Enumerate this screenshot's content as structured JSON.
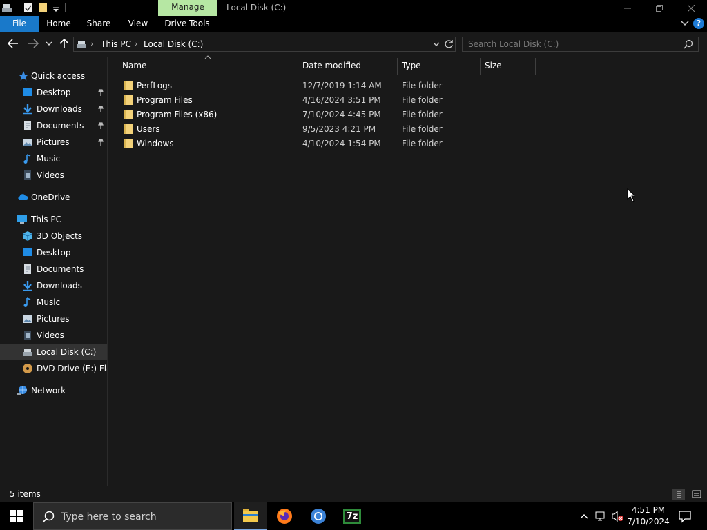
{
  "titlebar": {
    "manage_tab": "Manage",
    "window_title": "Local Disk (C:)"
  },
  "ribbon": {
    "tabs": [
      "File",
      "Home",
      "Share",
      "View",
      "Drive Tools"
    ],
    "help": "?"
  },
  "address": {
    "breadcrumbs": [
      "This PC",
      "Local Disk (C:)"
    ],
    "search_placeholder": "Search Local Disk (C:)"
  },
  "nav": {
    "quick_access": "Quick access",
    "quick_items": [
      "Desktop",
      "Downloads",
      "Documents",
      "Pictures",
      "Music",
      "Videos"
    ],
    "onedrive": "OneDrive",
    "this_pc": "This PC",
    "pc_items": [
      "3D Objects",
      "Desktop",
      "Documents",
      "Downloads",
      "Music",
      "Pictures",
      "Videos",
      "Local Disk (C:)",
      "DVD Drive (E:) Flato"
    ],
    "network": "Network"
  },
  "filelist": {
    "columns": [
      "Name",
      "Date modified",
      "Type",
      "Size"
    ],
    "rows": [
      {
        "name": "PerfLogs",
        "date": "12/7/2019 1:14 AM",
        "type": "File folder"
      },
      {
        "name": "Program Files",
        "date": "4/16/2024 3:51 PM",
        "type": "File folder"
      },
      {
        "name": "Program Files (x86)",
        "date": "7/10/2024 4:45 PM",
        "type": "File folder"
      },
      {
        "name": "Users",
        "date": "9/5/2023 4:21 PM",
        "type": "File folder"
      },
      {
        "name": "Windows",
        "date": "4/10/2024 1:54 PM",
        "type": "File folder"
      }
    ]
  },
  "status": {
    "item_count": "5 items"
  },
  "taskbar": {
    "search_placeholder": "Type here to search",
    "time": "4:51 PM",
    "date": "7/10/2024",
    "apps": [
      "file-explorer-icon",
      "firefox-icon",
      "chrome-icon",
      "7zip-icon"
    ],
    "sevenzip_label": "7z"
  },
  "colors": {
    "accent": "#1979ca",
    "manage": "#b6e7a3",
    "folder": "#f3d27a"
  }
}
